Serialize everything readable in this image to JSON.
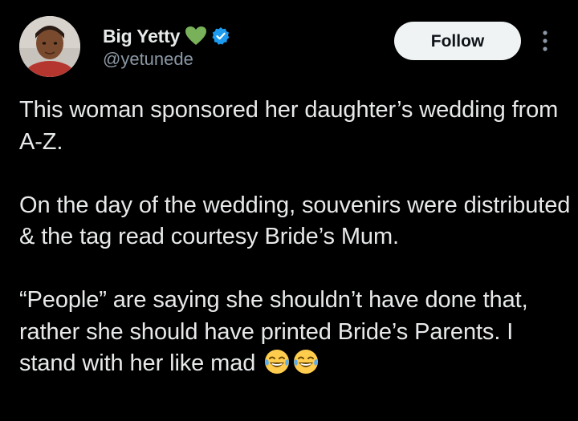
{
  "author": {
    "display_name": "Big Yetty",
    "handle": "@yetunede",
    "name_emoji": "green-heart-icon",
    "verified_icon": "verified-badge-icon",
    "verified_color": "#1d9bf0",
    "heart_color": "#78b159"
  },
  "actions": {
    "follow_label": "Follow",
    "more_icon": "more-options-icon"
  },
  "tweet": {
    "paragraphs": [
      "This woman sponsored her daughter’s wedding from A-Z.",
      "On the day of the wedding, souvenirs were distributed & the tag read courtesy Bride’s Mum.",
      " “People” are saying she shouldn’t have done that, rather she should have printed Bride’s Parents. I stand with her like mad"
    ],
    "trailing_emojis": [
      "face-with-tears-of-joy-icon",
      "face-with-tears-of-joy-icon"
    ]
  },
  "colors": {
    "background": "#000000",
    "text": "#e7e9ea",
    "secondary_text": "#8b98a5",
    "follow_bg": "#eff3f4"
  }
}
